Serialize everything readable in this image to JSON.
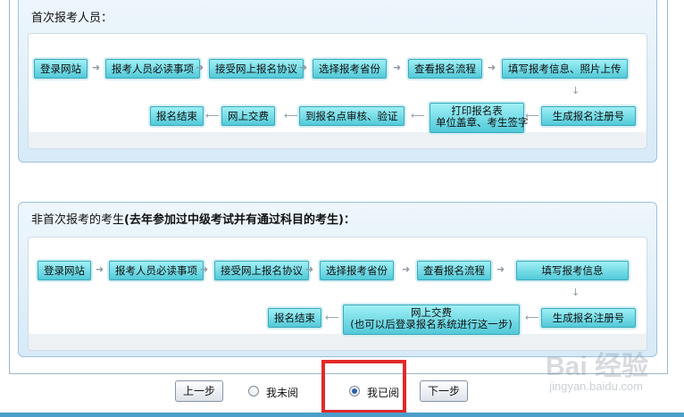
{
  "section1": {
    "title": "首次报考人员：",
    "row1": [
      "登录网站",
      "报考人员必读事项",
      "接受网上报名协议",
      "选择报考省份",
      "查看报名流程",
      "填写报考信息、照片上传"
    ],
    "row2": [
      "生成报名注册号",
      "打印报名表",
      "单位盖章、考生签字",
      "到报名点审核、验证",
      "网上交费",
      "报名结束"
    ]
  },
  "section2": {
    "title_normal": "非首次报考的考生",
    "title_bold": "(去年参加过中级考试并有通过科目的考生)：",
    "row1": [
      "登录网站",
      "报考人员必读事项",
      "接受网上报名协议",
      "选择报考省份",
      "查看报名流程",
      "填写报考信息"
    ],
    "row2": [
      "生成报名注册号",
      "网上交费",
      "(也可以后登录报名系统进行这一步)",
      "报名结束"
    ]
  },
  "nav": {
    "prev": "上一步",
    "not_read": "我未阅",
    "read": "我已阅",
    "next": "下一步",
    "selected": "我已阅"
  },
  "watermark": {
    "brand": "Bai 经验",
    "url": "jingyan.baidu.com"
  },
  "icons": {
    "right_arrow": "arrow-right-icon",
    "left_arrow": "arrow-left-icon",
    "down_arrow": "arrow-down-icon"
  }
}
